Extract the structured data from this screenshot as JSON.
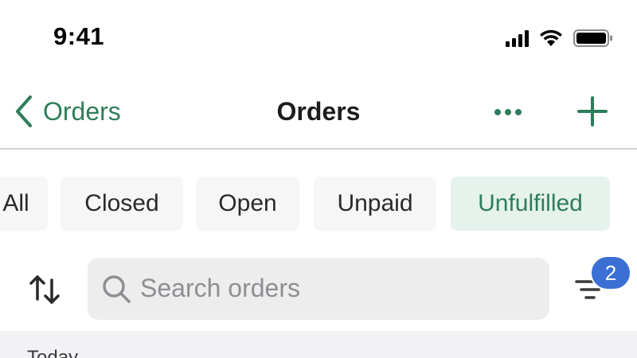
{
  "status_bar": {
    "time": "9:41",
    "icons": [
      "cellular-signal-icon",
      "wifi-icon",
      "battery-icon"
    ]
  },
  "nav": {
    "back_label": "Orders",
    "title": "Orders",
    "icons": [
      "chevron-left-icon",
      "more-icon",
      "plus-icon"
    ]
  },
  "filters": {
    "tabs": [
      {
        "label": "All",
        "active": false
      },
      {
        "label": "Closed",
        "active": false
      },
      {
        "label": "Open",
        "active": false
      },
      {
        "label": "Unpaid",
        "active": false
      },
      {
        "label": "Unfulfilled",
        "active": true
      }
    ]
  },
  "search": {
    "placeholder": "Search orders",
    "value": "",
    "filter_count": "2",
    "icons": [
      "sort-arrows-icon",
      "search-icon",
      "filter-icon"
    ]
  },
  "list": {
    "section_label": "Today"
  },
  "colors": {
    "accent": "#2e7d5b",
    "active_tab_bg": "#e6f2ec",
    "badge": "#3b6fd4",
    "search_bg": "#ededee"
  }
}
